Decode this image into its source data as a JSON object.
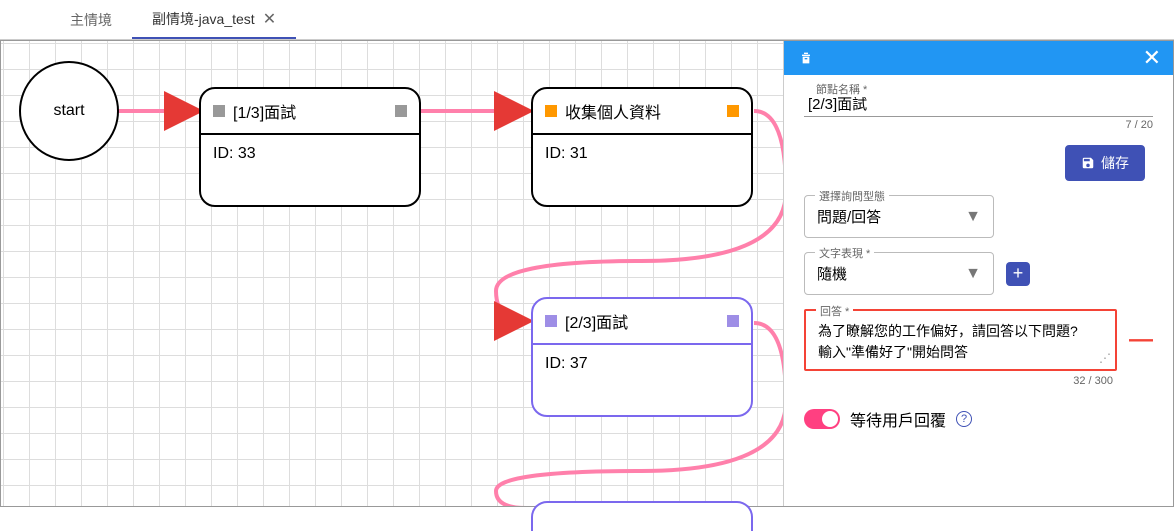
{
  "tabs": {
    "main": "主情境",
    "sub": "副情境-java_test"
  },
  "startLabel": "start",
  "nodes": {
    "a": {
      "title": "[1/3]面試",
      "id": "ID: 33"
    },
    "b": {
      "title": "收集個人資料",
      "id": "ID: 31"
    },
    "c": {
      "title": "[2/3]面試",
      "id": "ID: 37"
    }
  },
  "panel": {
    "nameLabel": "節點名稱 *",
    "nameValue": "[2/3]面試",
    "nameCounter": "7 / 20",
    "saveLabel": "儲存",
    "qtypeLabel": "選擇詢問型態",
    "qtypeValue": "問題/回答",
    "textExprLabel": "文字表現 *",
    "textExprValue": "隨機",
    "answerLabel": "回答 *",
    "answerText": "為了瞭解您的工作偏好，請回答以下問題?\n輸入\"準備好了\"開始問答",
    "answerCounter": "32 / 300",
    "waitLabel": "等待用戶回覆"
  }
}
